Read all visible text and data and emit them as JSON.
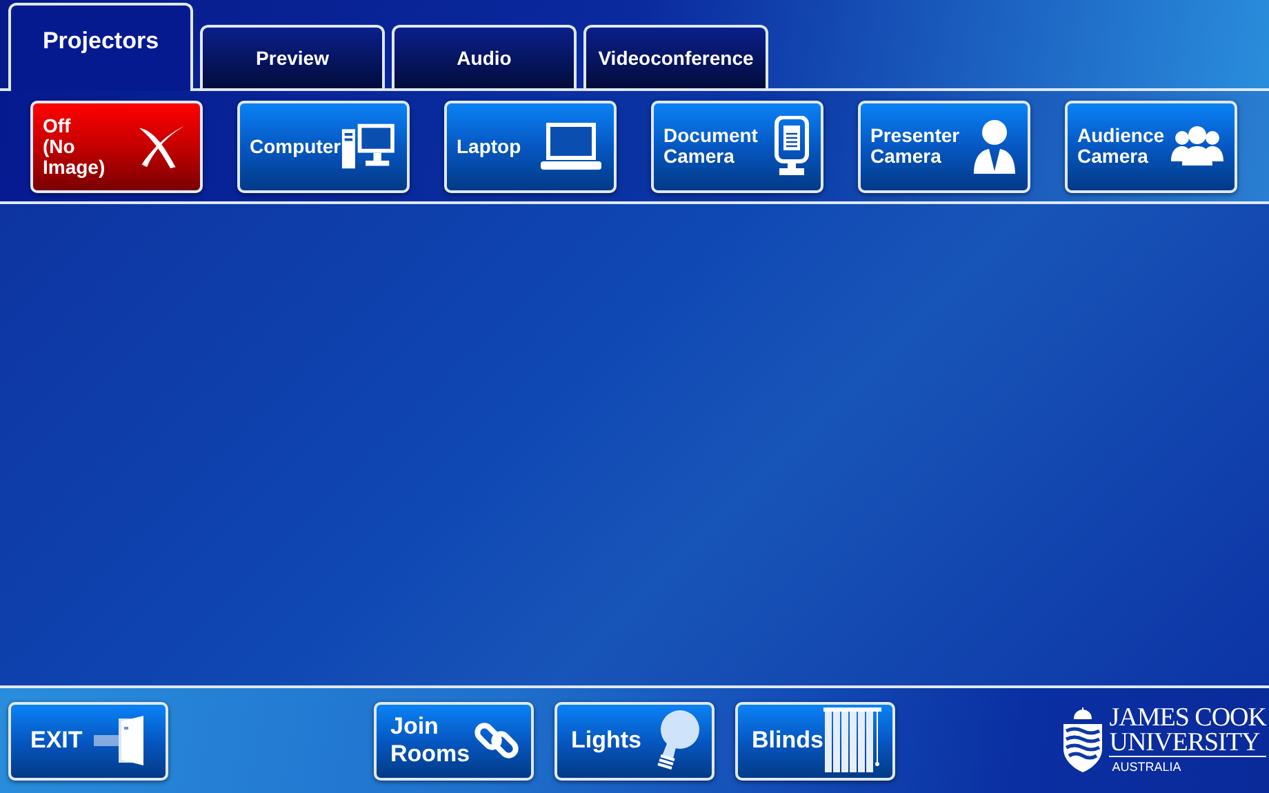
{
  "tabs": [
    {
      "label": "Projectors",
      "selected": true
    },
    {
      "label": "Preview",
      "selected": false
    },
    {
      "label": "Audio",
      "selected": false
    },
    {
      "label": "Videoconference",
      "selected": false
    }
  ],
  "sources": [
    {
      "kind": "off",
      "label": "Off\n(No Image)"
    },
    {
      "kind": "computer",
      "label": "Computer"
    },
    {
      "kind": "laptop",
      "label": "Laptop"
    },
    {
      "kind": "document-camera",
      "label": "Document\nCamera"
    },
    {
      "kind": "presenter",
      "label": "Presenter\nCamera"
    },
    {
      "kind": "audience",
      "label": "Audience\nCamera"
    }
  ],
  "bottom_buttons": [
    {
      "kind": "exit",
      "label": "EXIT"
    },
    {
      "kind": "join",
      "label": "Join\nRooms"
    },
    {
      "kind": "lights",
      "label": "Lights"
    },
    {
      "kind": "blinds",
      "label": "Blinds"
    }
  ],
  "logo": {
    "name_line_1": "JAMES COOK",
    "name_line_2": "UNIVERSITY",
    "country": "AUSTRALIA"
  }
}
